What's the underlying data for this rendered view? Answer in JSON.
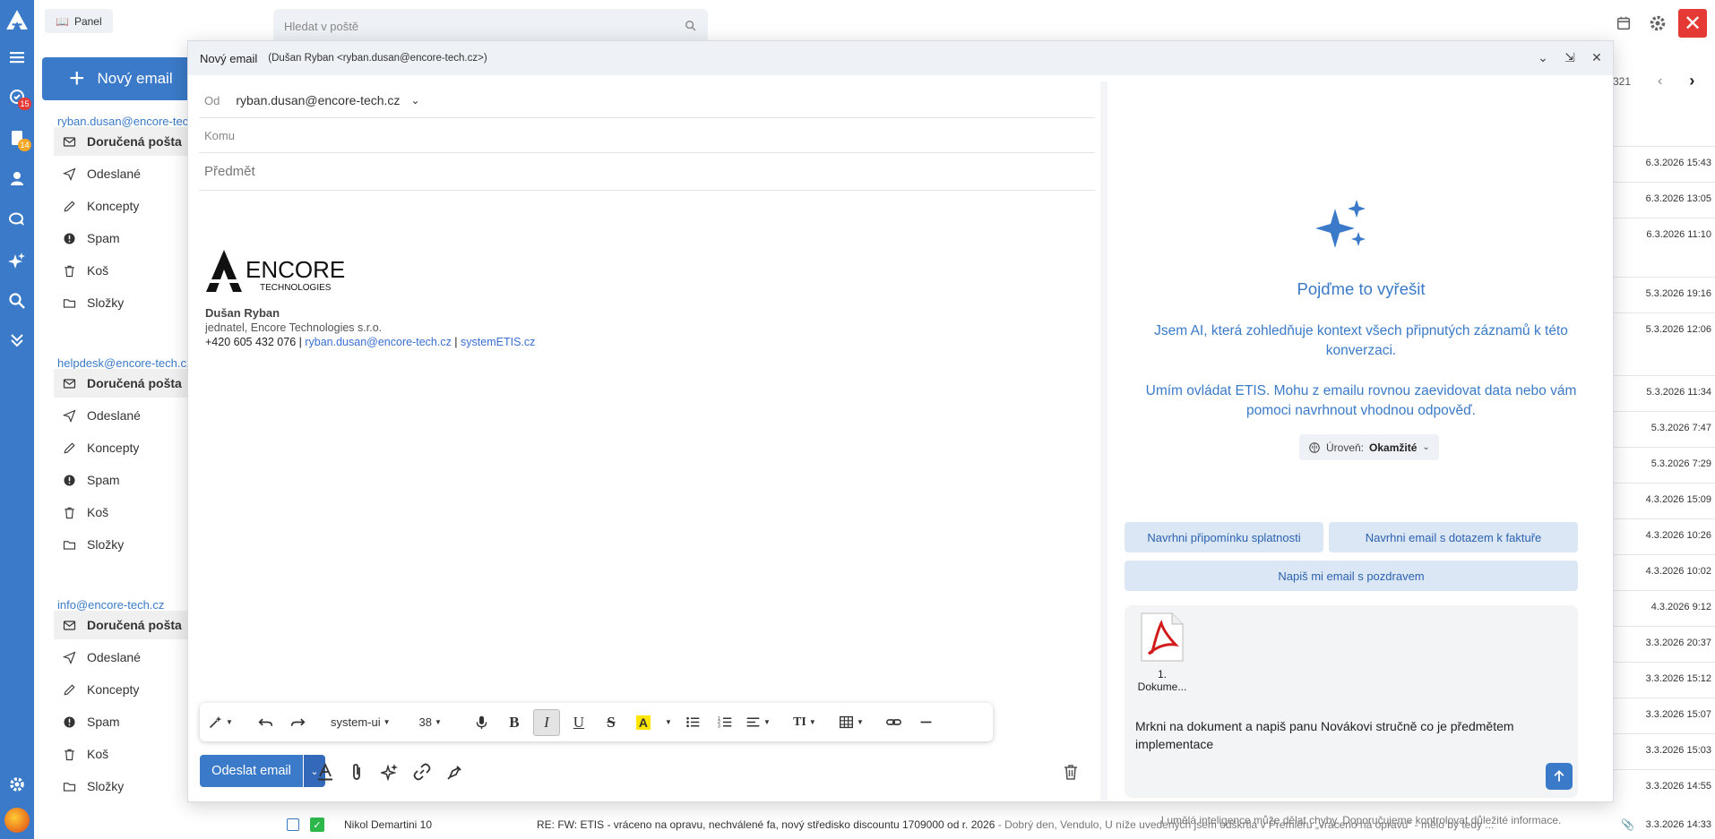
{
  "rail": {
    "badges": {
      "tasks": "15",
      "docs": "14"
    }
  },
  "sidebar": {
    "panel_label": "Panel",
    "new_email_label": "Nový email",
    "accounts": [
      {
        "email": "ryban.dusan@encore-tech.cz",
        "folders": [
          "Doručená pošta",
          "Odeslané",
          "Koncepty",
          "Spam",
          "Koš",
          "Složky"
        ]
      },
      {
        "email": "helpdesk@encore-tech.cz",
        "folders": [
          "Doručená pošta",
          "Odeslané",
          "Koncepty",
          "Spam",
          "Koš",
          "Složky"
        ]
      },
      {
        "email": "info@encore-tech.cz",
        "folders": [
          "Doručená pošta",
          "Odeslané",
          "Koncepty",
          "Spam",
          "Koš",
          "Složky"
        ]
      }
    ]
  },
  "search": {
    "placeholder": "Hledat v poště"
  },
  "list": {
    "pager": "321",
    "dates": [
      "6.3.2026 15:43",
      "6.3.2026 13:05",
      "6.3.2026 11:10",
      "5.3.2026 19:16",
      "5.3.2026 12:06",
      "5.3.2026 11:34",
      "5.3.2026 7:47",
      "5.3.2026 7:29",
      "4.3.2026 15:09",
      "4.3.2026 10:26",
      "4.3.2026 10:02",
      "4.3.2026 9:12",
      "3.3.2026 20:37",
      "3.3.2026 15:12",
      "3.3.2026 15:07",
      "3.3.2026 15:03",
      "3.3.2026 14:55"
    ],
    "last_row": {
      "sender": "Nikol Demartini 10",
      "subject": "RE: FW: ETIS - vráceno na opravu, nechválené fa, nový středisko discountu 1709000 od r. 2026",
      "preview": " - Dobrý den, Vendulo, U níže uvedených jsem odškrtla v Premiéru „vráceno na opravu“ - mělo by tedy ...",
      "date": "3.3.2026 14:33"
    }
  },
  "compose": {
    "title": "Nový email",
    "subtitle": "(Dušan Ryban <ryban.dusan@encore-tech.cz>)",
    "from_label": "Od",
    "from_value": "ryban.dusan@encore-tech.cz",
    "to_placeholder": "Komu",
    "subject_placeholder": "Předmět",
    "logo_main": "ENCORE",
    "logo_sub": "TECHNOLOGIES",
    "sig_name": "Dušan Ryban",
    "sig_role": "jednatel, Encore Technologies s.r.o.",
    "sig_phone": "+420 605 432 076 | ",
    "sig_email": "ryban.dusan@encore-tech.cz",
    "sig_sep": " | ",
    "sig_web": "systemETIS.cz",
    "toolbar": {
      "font": "system-ui",
      "size": "38"
    },
    "send_label": "Odeslat email"
  },
  "ai": {
    "title": "Pojďme to vyřešit",
    "text1": "Jsem AI, která zohledňuje kontext všech připnutých záznamů k této konverzaci.",
    "text2": "Umím ovládat ETIS. Mohu z emailu rovnou zaevidovat data nebo vám pomoci navrhnout vhodnou odpověď.",
    "level_label": "Úroveň:",
    "level_value": "Okamžité",
    "chips": [
      "Navrhni připomínku splatnosti",
      "Navrhni email s dotazem k faktuře",
      "Napiš mi email s pozdravem"
    ],
    "attachment": "1. Dokume...",
    "message": "Mrkni na dokument a napiš panu Novákovi stručně co je předmětem implementace",
    "note": "I umělá inteligence může dělat chyby. Doporučujeme kontrolovat důležité informace."
  },
  "colors": {
    "accent": "#3a7ac8",
    "danger": "#e53935",
    "chip_bg": "#dbe7f4"
  }
}
